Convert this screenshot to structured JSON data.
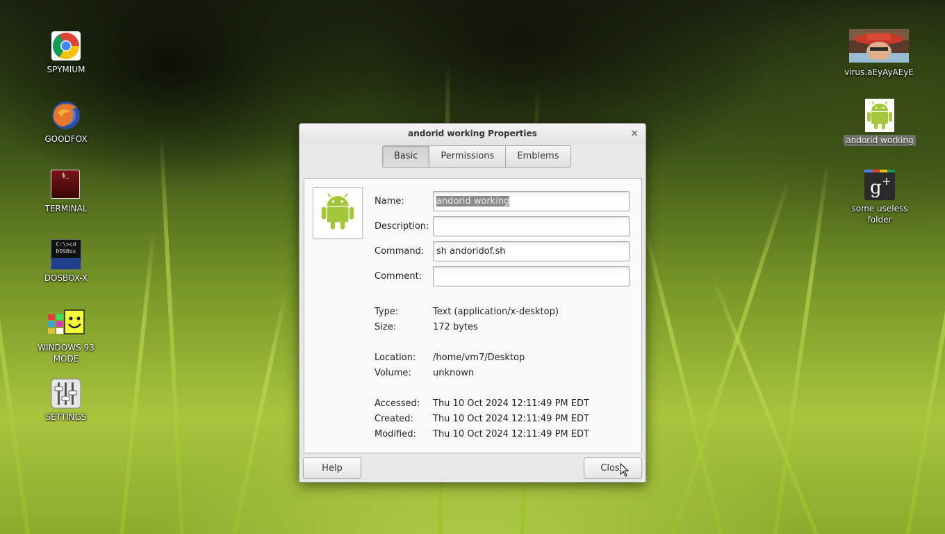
{
  "desktop": {
    "left_icons": [
      {
        "label": "SPYMIUM"
      },
      {
        "label": "GOODFOX"
      },
      {
        "label": "TERMINAL"
      },
      {
        "label": "DOSBOX-X"
      },
      {
        "label": "WINDOWS 93 MODE"
      },
      {
        "label": "SETTINGS"
      }
    ],
    "right_icons": [
      {
        "label": "virus.aEyAyAEyE"
      },
      {
        "label": "andorid working"
      },
      {
        "label": "some useless folder"
      }
    ],
    "dosbox_icon_text": [
      "C:\\>cd",
      "DOSBox"
    ],
    "terminal_icon_text": "$_"
  },
  "dialog": {
    "title": "andorid working Properties",
    "tabs": [
      "Basic",
      "Permissions",
      "Emblems"
    ],
    "fields": {
      "name_label": "Name:",
      "name_value": "andorid working",
      "description_label": "Description:",
      "description_value": "",
      "command_label": "Command:",
      "command_value": "sh andoridof.sh",
      "comment_label": "Comment:",
      "comment_value": ""
    },
    "info": {
      "type_label": "Type:",
      "type_value": "Text (application/x-desktop)",
      "size_label": "Size:",
      "size_value": "172 bytes",
      "location_label": "Location:",
      "location_value": "/home/vm7/Desktop",
      "volume_label": "Volume:",
      "volume_value": "unknown",
      "accessed_label": "Accessed:",
      "accessed_value": "Thu 10 Oct 2024 12:11:49 PM EDT",
      "created_label": "Created:",
      "created_value": "Thu 10 Oct 2024 12:11:49 PM EDT",
      "modified_label": "Modified:",
      "modified_value": "Thu 10 Oct 2024 12:11:49 PM EDT"
    },
    "help_button": "Help",
    "close_button": "Close",
    "close_glyph": "×"
  },
  "colors": {
    "android_green": "#a4c639",
    "accent_selection": "#8a8a8a"
  }
}
